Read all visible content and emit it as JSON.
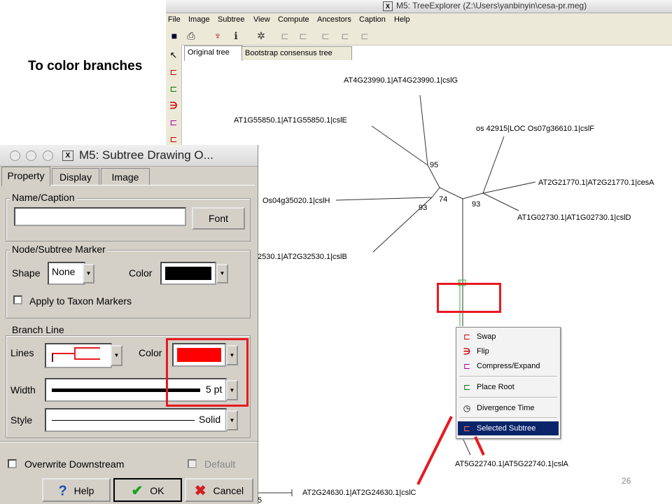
{
  "slide": {
    "title": "To color branches",
    "page_number": "26"
  },
  "main_window": {
    "title": "M5: TreeExplorer (Z:\\Users\\yanbinyin\\cesa-pr.meg)",
    "menu": [
      "File",
      "Image",
      "Subtree",
      "View",
      "Compute",
      "Ancestors",
      "Caption",
      "Help"
    ],
    "tabs": [
      "Original tree",
      "Bootstrap consensus tree"
    ],
    "tree": {
      "taxa": [
        "AT4G23990.1|AT4G23990.1|cslG",
        "AT1G55850.1|AT1G55850.1|cslE",
        "os 42915|LOC Os07g36610.1|cslF",
        "AT2G21770.1|AT2G21770.1|cesA",
        "Os04g35020.1|cslH",
        "AT1G02730.1|AT1G02730.1|cslD",
        "2530.1|AT2G32530.1|cslB",
        "AT5G22740.1|AT5G22740.1|cslA",
        "AT2G24630.1|AT2G24630.1|cslC"
      ],
      "bootstrap": [
        "95",
        "74",
        "93",
        "93",
        ".5"
      ]
    },
    "context_menu": {
      "items": [
        {
          "label": "Swap",
          "icon": "swap-icon"
        },
        {
          "label": "Flip",
          "icon": "flip-icon"
        },
        {
          "label": "Compress/Expand",
          "icon": "compress-expand-icon"
        },
        {
          "label": "Place Root",
          "icon": "place-root-icon"
        },
        {
          "label": "Divergence Time",
          "icon": "divergence-time-icon"
        },
        {
          "label": "Selected Subtree",
          "icon": "selected-subtree-icon"
        }
      ],
      "selected": "Selected Subtree"
    }
  },
  "dialog": {
    "title": "M5: Subtree Drawing O...",
    "tabs": [
      "Property",
      "Display",
      "Image"
    ],
    "name_caption": {
      "group": "Name/Caption",
      "value": "",
      "font_button": "Font"
    },
    "marker": {
      "group": "Node/Subtree Marker",
      "shape_label": "Shape",
      "shape_value": "None",
      "color_label": "Color",
      "color_value": "#000000",
      "apply_label": "Apply to Taxon Markers",
      "apply_checked": false
    },
    "branch": {
      "group": "Branch Line",
      "lines_label": "Lines",
      "color_label": "Color",
      "color_value": "#ff0000",
      "width_label": "Width",
      "width_value": "5 pt",
      "style_label": "Style",
      "style_value": "Solid"
    },
    "overwrite_label": "Overwrite Downstream",
    "overwrite_checked": false,
    "default_label": "Default",
    "default_checked": false,
    "buttons": {
      "help": "Help",
      "ok": "OK",
      "cancel": "Cancel"
    }
  },
  "colors": {
    "highlight": "#e8191f",
    "menu_selection": "#0a246a",
    "dialog_bg": "#d4d0c8"
  }
}
